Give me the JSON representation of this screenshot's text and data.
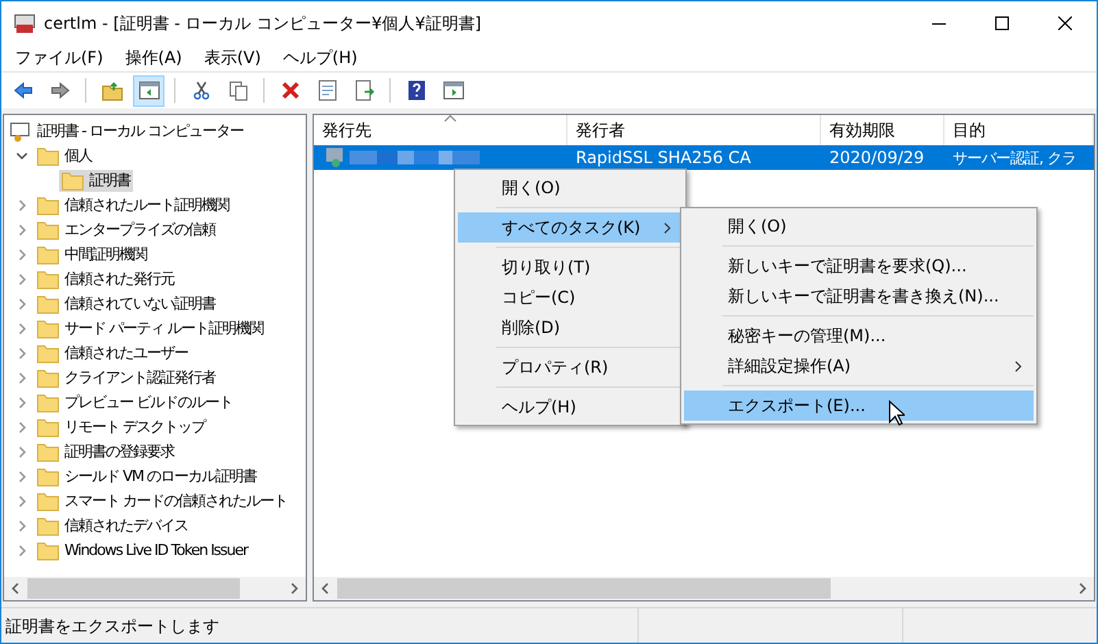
{
  "window": {
    "title": "certlm - [証明書 - ローカル コンピューター¥個人¥証明書]"
  },
  "menu_bar": [
    "ファイル(F)",
    "操作(A)",
    "表示(V)",
    "ヘルプ(H)"
  ],
  "toolbar": [
    {
      "kind": "back"
    },
    {
      "kind": "forward"
    },
    {
      "kind": "sep"
    },
    {
      "kind": "up",
      "selected": false
    },
    {
      "kind": "tree",
      "selected": true
    },
    {
      "kind": "sep"
    },
    {
      "kind": "cut"
    },
    {
      "kind": "copy"
    },
    {
      "kind": "sep"
    },
    {
      "kind": "delete"
    },
    {
      "kind": "properties"
    },
    {
      "kind": "export"
    },
    {
      "kind": "sep"
    },
    {
      "kind": "help"
    },
    {
      "kind": "pane"
    }
  ],
  "tree": {
    "label": "証明書 - ローカル コンピューター",
    "children": [
      {
        "label": "個人",
        "expanded": true,
        "selected": false,
        "children": [
          {
            "label": "証明書",
            "selected": true
          }
        ]
      },
      {
        "label": "信頼されたルート証明機関",
        "expanded": false,
        "selected": false
      },
      {
        "label": "エンタープライズの信頼",
        "expanded": false,
        "selected": false
      },
      {
        "label": "中間証明機関",
        "expanded": false,
        "selected": false
      },
      {
        "label": "信頼された発行元",
        "expanded": false,
        "selected": false
      },
      {
        "label": "信頼されていない証明書",
        "expanded": false,
        "selected": false
      },
      {
        "label": "サード パーティ ルート証明機関",
        "expanded": false,
        "selected": false
      },
      {
        "label": "信頼されたユーザー",
        "expanded": false,
        "selected": false
      },
      {
        "label": "クライアント認証発行者",
        "expanded": false,
        "selected": false
      },
      {
        "label": "プレビュー ビルドのルート",
        "expanded": false,
        "selected": false
      },
      {
        "label": "リモート デスクトップ",
        "expanded": false,
        "selected": false
      },
      {
        "label": "証明書の登録要求",
        "expanded": false,
        "selected": false
      },
      {
        "label": "シールド VM のローカル証明書",
        "expanded": false,
        "selected": false
      },
      {
        "label": "スマート カードの信頼されたルート",
        "expanded": false,
        "selected": false
      },
      {
        "label": "信頼されたデバイス",
        "expanded": false,
        "selected": false
      },
      {
        "label": "Windows Live ID Token Issuer",
        "expanded": false,
        "selected": false
      }
    ]
  },
  "table": {
    "columns": [
      "発行先",
      "発行者",
      "有効期限",
      "目的"
    ],
    "rows": [
      {
        "selected": true,
        "cells": [
          "",
          "RapidSSL SHA256 CA",
          "2020/09/29",
          "サーバー認証, クラ"
        ]
      }
    ]
  },
  "context_menu": [
    {
      "kind": "item",
      "label": "開く(O)",
      "selected": false
    },
    {
      "kind": "sep"
    },
    {
      "kind": "item",
      "label": "すべてのタスク(K)",
      "selected": true,
      "submenu": true
    },
    {
      "kind": "sep"
    },
    {
      "kind": "item",
      "label": "切り取り(T)",
      "selected": false
    },
    {
      "kind": "item",
      "label": "コピー(C)",
      "selected": false
    },
    {
      "kind": "item",
      "label": "削除(D)",
      "selected": false
    },
    {
      "kind": "sep"
    },
    {
      "kind": "item",
      "label": "プロパティ(R)",
      "selected": false
    },
    {
      "kind": "sep"
    },
    {
      "kind": "item",
      "label": "ヘルプ(H)",
      "selected": false
    }
  ],
  "submenu": [
    {
      "kind": "item",
      "label": "開く(O)",
      "selected": false
    },
    {
      "kind": "sep"
    },
    {
      "kind": "item",
      "label": "新しいキーで証明書を要求(Q)...",
      "selected": false
    },
    {
      "kind": "item",
      "label": "新しいキーで証明書を書き換え(N)...",
      "selected": false
    },
    {
      "kind": "sep"
    },
    {
      "kind": "item",
      "label": "秘密キーの管理(M)...",
      "selected": false
    },
    {
      "kind": "item",
      "label": "詳細設定操作(A)",
      "selected": false,
      "submenu": true
    },
    {
      "kind": "sep"
    },
    {
      "kind": "item",
      "label": "エクスポート(E)...",
      "selected": true
    }
  ],
  "status_bar": "証明書をエクスポートします"
}
